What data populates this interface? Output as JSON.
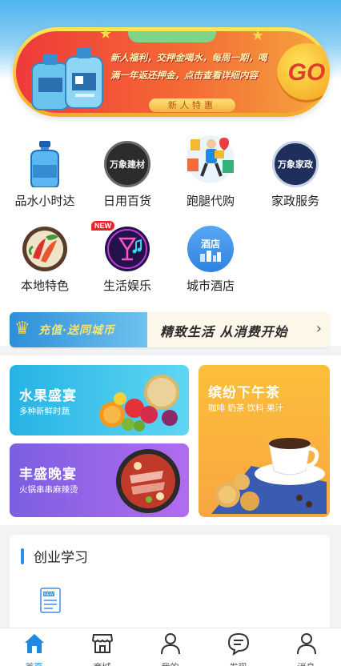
{
  "promo": {
    "line1": "新人福利，交押金喝水，每周一期，喝",
    "line2": "满一年返还押金，点击查看详细内容",
    "badge": "新人特惠",
    "go": "GO"
  },
  "categories": [
    {
      "label": "品水小时达",
      "icon": "water-bottle-icon"
    },
    {
      "label": "日用百货",
      "icon": "building-materials-logo",
      "logo_text": "万象建材"
    },
    {
      "label": "跑腿代购",
      "icon": "courier-icon"
    },
    {
      "label": "家政服务",
      "icon": "housekeeping-logo",
      "logo_text": "万象家政"
    },
    {
      "label": "本地特色",
      "icon": "local-specialty-icon"
    },
    {
      "label": "生活娱乐",
      "icon": "entertainment-icon",
      "badge": "NEW"
    },
    {
      "label": "城市酒店",
      "icon": "hotel-icon",
      "logo_text": "酒店"
    }
  ],
  "recharge": {
    "left_text": "充值·送同城币",
    "slogan": "精致生活  从消费开始",
    "arrow": "›"
  },
  "cards": {
    "fruit": {
      "title": "水果盛宴",
      "subtitle": "多种新鲜时蔬"
    },
    "dinner": {
      "title": "丰盛晚宴",
      "subtitle": "火锅串串麻辣烫"
    },
    "tea": {
      "title": "缤纷下午茶",
      "subtitle": "咖啡 奶茶 饮料 果汁"
    }
  },
  "learn": {
    "title": "创业学习",
    "item_icon_text": "NEW"
  },
  "tabbar": [
    {
      "label": "首页",
      "active": true
    },
    {
      "label": "商城",
      "active": false
    },
    {
      "label": "我的",
      "active": false
    },
    {
      "label": "发现",
      "active": false
    },
    {
      "label": "消息",
      "active": false
    }
  ],
  "colors": {
    "accent": "#1e88e5",
    "promo_red": "#ef3a3a",
    "promo_yellow": "#ffe55a"
  }
}
